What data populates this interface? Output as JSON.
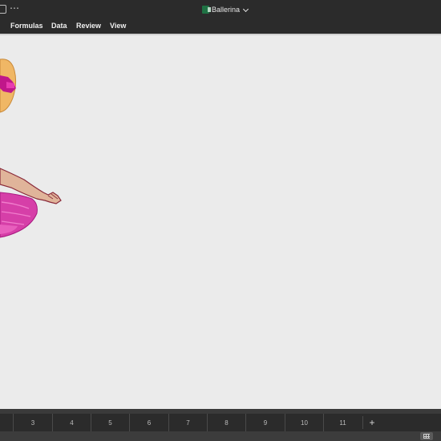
{
  "window": {
    "title": "Ballerina",
    "more_glyph": "⋯"
  },
  "ribbon": {
    "tabs": [
      "Formulas",
      "Data",
      "Review",
      "View"
    ]
  },
  "sheets": {
    "tabs": [
      "3",
      "4",
      "5",
      "6",
      "7",
      "8",
      "9",
      "10",
      "11"
    ],
    "add_label": "+"
  },
  "colors": {
    "chrome_dark": "#2b2b2b",
    "canvas": "#ebebeb",
    "tutu": "#d63fa8",
    "bow": "#c0178a",
    "hair": "#f0b765",
    "skin": "#e0b49a",
    "outline": "#8a2a3a"
  },
  "canvas_art": {
    "subject": "pixel-art ballerina (partially visible at left edge)"
  }
}
